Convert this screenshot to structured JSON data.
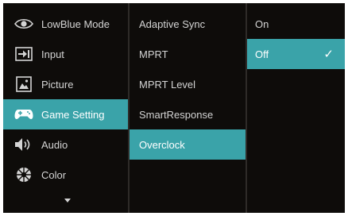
{
  "menu": {
    "items": [
      {
        "label": "LowBlue Mode",
        "icon": "eye-icon"
      },
      {
        "label": "Input",
        "icon": "input-arrow-icon"
      },
      {
        "label": "Picture",
        "icon": "picture-icon"
      },
      {
        "label": "Game Setting",
        "icon": "gamepad-icon",
        "selected": true
      },
      {
        "label": "Audio",
        "icon": "speaker-icon"
      },
      {
        "label": "Color",
        "icon": "color-palette-icon"
      }
    ],
    "more_indicator": "chevron-down-icon"
  },
  "submenu": {
    "items": [
      {
        "label": "Adaptive Sync"
      },
      {
        "label": "MPRT"
      },
      {
        "label": "MPRT Level"
      },
      {
        "label": "SmartResponse"
      },
      {
        "label": "Overclock",
        "selected": true
      }
    ]
  },
  "options": {
    "items": [
      {
        "label": "On"
      },
      {
        "label": "Off",
        "selected": true,
        "checked": true
      }
    ],
    "check_mark": "✓"
  },
  "colors": {
    "highlight": "#3aa3a9",
    "background": "#0e0c0a",
    "text": "#d4d4d4",
    "divider": "#2e2b28"
  }
}
